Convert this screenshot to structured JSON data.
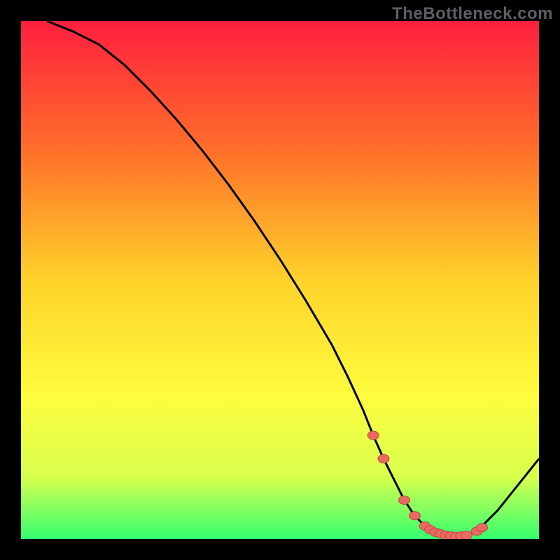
{
  "watermark": "TheBottleneck.com",
  "colors": {
    "black": "#000000",
    "grad_top": "#ff1f3f",
    "grad_mid1": "#ff6f2a",
    "grad_mid2": "#ffd22a",
    "grad_mid3": "#fffc3f",
    "grad_mid4": "#d8ff4d",
    "grad_bottom": "#35ff6f",
    "curve": "#000000",
    "dot_fill": "#ea6a62",
    "dot_stroke": "#b94a42"
  },
  "chart_data": {
    "type": "line",
    "title": "",
    "xlabel": "",
    "ylabel": "",
    "xlim": [
      0,
      100
    ],
    "ylim": [
      0,
      100
    ],
    "series": [
      {
        "name": "curve",
        "x": [
          5,
          10,
          15,
          20,
          25,
          30,
          35,
          40,
          45,
          50,
          55,
          60,
          63,
          66,
          68,
          70,
          72,
          74,
          76,
          78,
          80,
          82,
          84,
          86,
          88,
          92,
          96,
          100
        ],
        "values": [
          100,
          98,
          95.5,
          91.5,
          86.5,
          81,
          75,
          68.5,
          61.5,
          54,
          46,
          37.5,
          31.5,
          25,
          20,
          15.5,
          11.5,
          7.5,
          4.5,
          2.5,
          1.3,
          0.7,
          0.5,
          0.7,
          1.5,
          5.5,
          10.5,
          15.5
        ]
      }
    ],
    "dots": {
      "x": [
        68,
        70,
        74,
        76,
        78,
        79,
        80,
        81,
        82,
        83,
        84,
        85,
        86,
        88,
        89
      ],
      "values": [
        20,
        15.5,
        7.5,
        4.5,
        2.5,
        1.8,
        1.3,
        1.0,
        0.7,
        0.6,
        0.5,
        0.6,
        0.7,
        1.5,
        2.2
      ]
    }
  }
}
